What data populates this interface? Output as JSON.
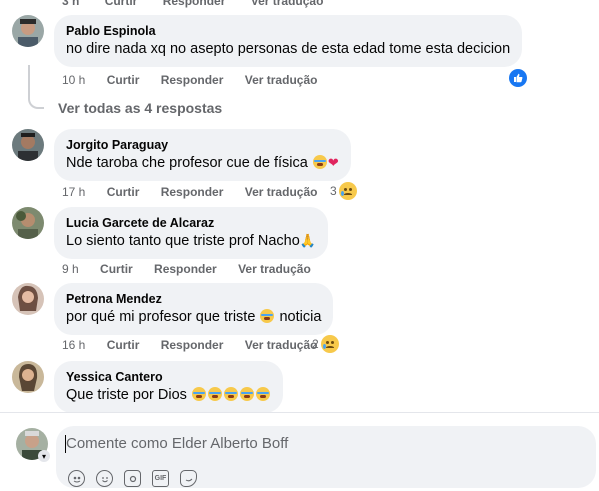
{
  "top_cut": {
    "time": "3 h",
    "like": "Curtir",
    "reply": "Responder",
    "translate": "Ver tradução"
  },
  "comments": [
    {
      "author": "Pablo Espinola",
      "text": "no dire nada xq no asepto personas de esta edad tome esta decicion",
      "time": "10 h",
      "like": "Curtir",
      "reply": "Responder",
      "translate": "Ver tradução",
      "reaction": "like"
    },
    {
      "author": "Jorgito Paraguay",
      "text": "Nde taroba che profesor cue de física",
      "time": "17 h",
      "like": "Curtir",
      "reply": "Responder",
      "translate": "Ver tradução",
      "reaction_count": "3"
    },
    {
      "author": "Lucia Garcete de Alcaraz",
      "text": "Lo siento tanto que triste prof Nacho",
      "time": "9 h",
      "like": "Curtir",
      "reply": "Responder",
      "translate": "Ver tradução"
    },
    {
      "author": "Petrona Mendez",
      "text_before": "por qué mi profesor que triste",
      "text_after": "noticia",
      "time": "16 h",
      "like": "Curtir",
      "reply": "Responder",
      "translate": "Ver tradução",
      "reaction_count": "2"
    },
    {
      "author": "Yessica Cantero",
      "text": "Que triste por Dios"
    }
  ],
  "view_replies": "Ver todas as 4 respostas",
  "composer": {
    "placeholder": "Comente como Elder Alberto Boff",
    "tools": [
      "avatar-sticker-icon",
      "emoji-icon",
      "camera-icon",
      "gif-icon",
      "sticker-icon"
    ],
    "gif_label": "GIF"
  },
  "colors": {
    "bubble": "#f0f2f5",
    "meta": "#65676b",
    "like_blue": "#1877f2"
  }
}
